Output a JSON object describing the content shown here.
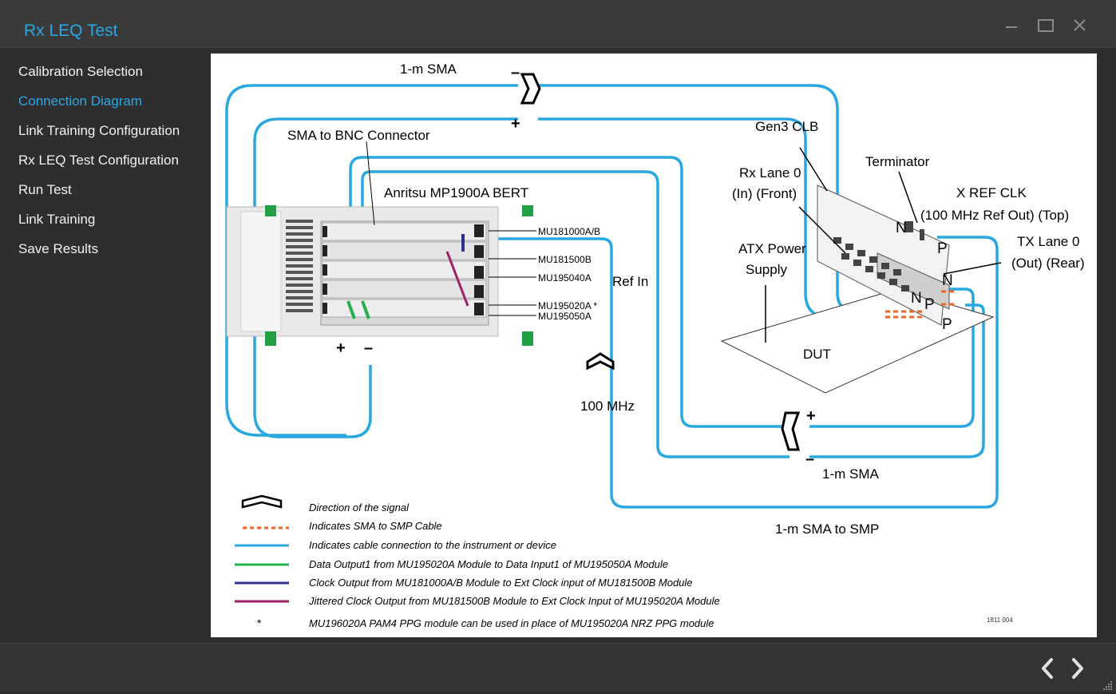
{
  "window": {
    "title": "Rx LEQ Test"
  },
  "sidebar": {
    "items": [
      {
        "label": "Calibration Selection",
        "active": false
      },
      {
        "label": "Connection Diagram",
        "active": true
      },
      {
        "label": "Link Training Configuration",
        "active": false
      },
      {
        "label": "Rx LEQ Test Configuration",
        "active": false
      },
      {
        "label": "Run Test",
        "active": false
      },
      {
        "label": "Link Training",
        "active": false
      },
      {
        "label": "Save Results",
        "active": false
      }
    ]
  },
  "diagram": {
    "labels": {
      "sma_top": "1-m SMA",
      "sma_to_bnc": "SMA to BNC Connector",
      "bert": "Anritsu MP1900A BERT",
      "mod1": "MU181000A/B",
      "mod2": "MU181500B",
      "mod3": "MU195040A",
      "mod4": "MU195020A *",
      "mod5": "MU195050A",
      "ref_in": "Ref In",
      "freq": "100 MHz",
      "gen3_clb": "Gen3 CLB",
      "terminator": "Terminator",
      "rx_lane_1": "Rx Lane 0",
      "rx_lane_2": "(In) (Front)",
      "xref_1": "X REF CLK",
      "xref_2": "(100 MHz Ref Out) (Top)",
      "atx_1": "ATX Power",
      "atx_2": "Supply",
      "tx_lane_1": "TX Lane 0",
      "tx_lane_2": "(Out) (Rear)",
      "dut": "DUT",
      "sma_bottom": "1-m SMA",
      "sma_to_smp": "1-m SMA to SMP",
      "plus": "+",
      "minus": "–",
      "pin_n": "N",
      "pin_p": "P",
      "fig_id": "1811 004"
    },
    "legend": [
      {
        "type": "arrow",
        "text": "Direction of the signal"
      },
      {
        "type": "dashed-orange",
        "color": "#f26522",
        "text": "Indicates SMA to SMP Cable"
      },
      {
        "type": "line",
        "color": "#29a8e0",
        "text": "Indicates cable connection to the instrument or device"
      },
      {
        "type": "line",
        "color": "#22b04b",
        "text": "Data Output1 from MU195020A Module to Data Input1 of MU195050A Module"
      },
      {
        "type": "line",
        "color": "#2e3192",
        "text": "Clock Output from MU181000A/B Module to Ext Clock input of MU181500B Module"
      },
      {
        "type": "line",
        "color": "#9e1f63",
        "text": "Jittered Clock Output from MU181500B Module to Ext Clock Input of MU195020A Module"
      },
      {
        "type": "star",
        "symbol": "*",
        "text": "MU196020A PAM4 PPG module can be used in place of MU195020A NRZ PPG module"
      }
    ]
  },
  "footer": {
    "prev_icon": "chevron-left-icon",
    "next_icon": "chevron-right-icon"
  },
  "colors": {
    "accent": "#2aa7e5",
    "cable": "#29a8e0",
    "smp": "#f26522"
  }
}
